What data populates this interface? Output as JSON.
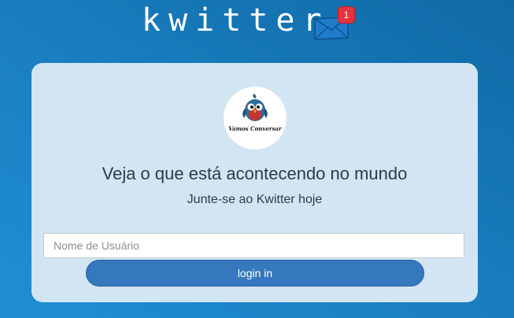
{
  "header": {
    "title": "kwitter",
    "mail_icon": "envelope-icon",
    "mail_badge_count": "1"
  },
  "card": {
    "logo_icon": "bird-mascot-logo",
    "logo_caption": "Vamos Conversar",
    "headline": "Veja o que está acontecendo no mundo",
    "subheadline": "Junte-se ao Kwitter hoje",
    "username_placeholder": "Nome de Usuário",
    "username_value": "",
    "login_label": "login in"
  },
  "colors": {
    "background": "#1a7fc0",
    "card": "#d2e5f3",
    "button": "#3578bd",
    "badge": "#e5343c"
  }
}
